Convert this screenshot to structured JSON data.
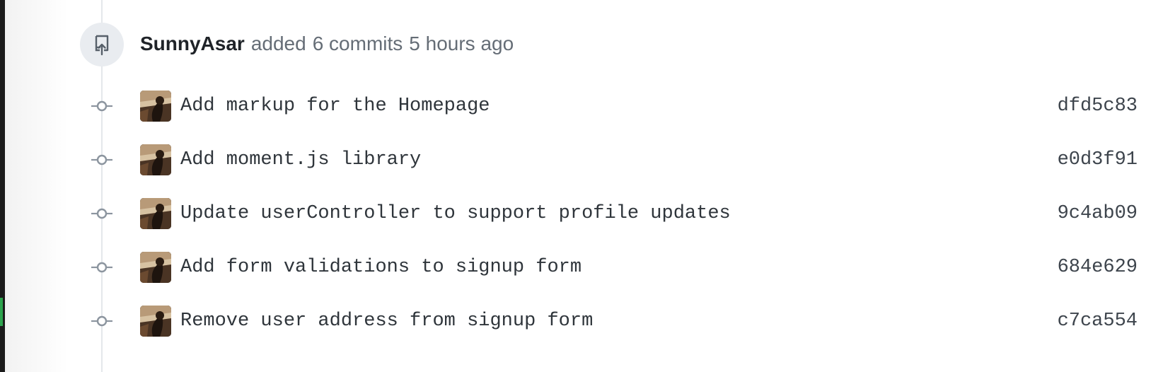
{
  "event": {
    "icon": "repo-push-icon",
    "author": "SunnyAsar",
    "action": "added",
    "count": "6 commits",
    "time": "5 hours ago"
  },
  "commits": [
    {
      "message": "Add markup for the Homepage",
      "sha": "dfd5c83"
    },
    {
      "message": "Add moment.js library",
      "sha": "e0d3f91"
    },
    {
      "message": "Update userController to support profile updates",
      "sha": "9c4ab09"
    },
    {
      "message": "Add form validations to signup form",
      "sha": "684e629"
    },
    {
      "message": "Remove user address from signup form",
      "sha": "c7ca554"
    }
  ],
  "colors": {
    "timeline": "#e4e7eb",
    "badge_bg": "#e9ecf0",
    "muted_text": "#656d76",
    "accent_green": "#2da44e"
  }
}
